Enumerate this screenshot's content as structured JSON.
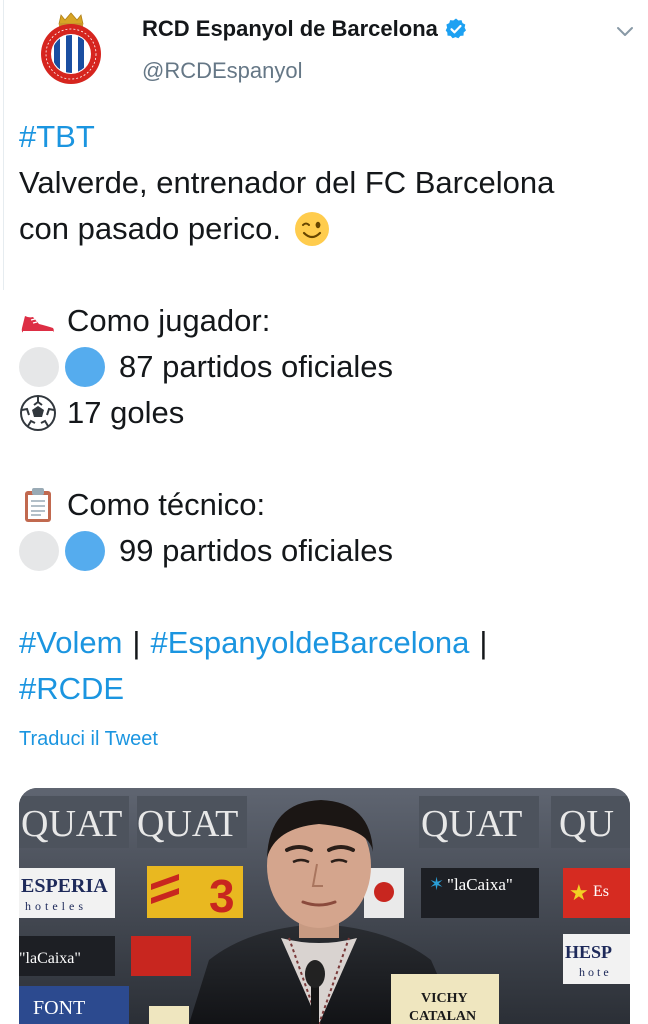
{
  "tweet": {
    "display_name": "RCD Espanyol de Barcelona",
    "handle": "@RCDEspanyol",
    "lines": {
      "tbt": "#TBT",
      "l1": "Valverde, entrenador del FC Barcelona",
      "l2": "con pasado perico.",
      "jugador": "Como jugador:",
      "partidos_jugador": "87 partidos oficiales",
      "goles": "17 goles",
      "tecnico": "Como técnico:",
      "partidos_tecnico": "99 partidos oficiales"
    },
    "hashtags": {
      "volem": "#Volem",
      "sep": "|",
      "espanyol": "#EspanyoldeBarcelona",
      "rcde": "#RCDE"
    },
    "translate_label": "Traduci il Tweet"
  },
  "media": {
    "sponsor_texts": {
      "quat": "QUAT",
      "qu": "QU",
      "esperia": "ESPERIA",
      "hoteles": "hoteles",
      "lacaixa": "\"laCaixa\"",
      "hesp": "HESP",
      "hote": "hote",
      "font": "FONT",
      "vichy": "VICHY",
      "catalan": "CATALAN",
      "esp_star": "Es"
    }
  },
  "icons": {
    "verified": "verified-badge-icon",
    "chevron": "chevron-down-icon",
    "wink": "winking-face-icon",
    "shoe": "running-shoe-icon",
    "ball": "soccer-ball-icon",
    "clipboard": "clipboard-icon"
  },
  "colors": {
    "link": "#1b95e0",
    "text": "#14171a",
    "secondary": "#657786",
    "espanyol_blue": "#55acee",
    "espanyol_white": "#e6e7e8"
  }
}
